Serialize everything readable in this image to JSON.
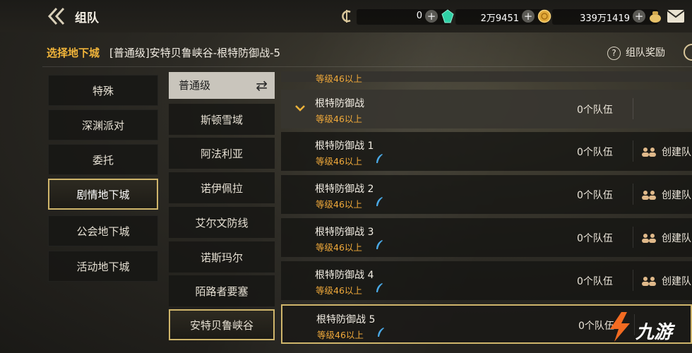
{
  "header": {
    "title": "组队",
    "currencies": [
      {
        "value": "0",
        "icon": "gem-icon",
        "color": "#2fd1a6"
      },
      {
        "value": "2万9451",
        "icon": "gold-coin-icon",
        "color": "#e1a93a"
      },
      {
        "value": "339万1419",
        "icon": "money-bag-icon",
        "color": "#e8c26a"
      }
    ]
  },
  "breadcrumb": {
    "label": "选择地下城",
    "current": "[普通级]安特贝鲁峡谷-根特防御战-5",
    "reward": "组队奖励"
  },
  "categories": [
    {
      "label": "特殊",
      "selected": false
    },
    {
      "label": "深渊派对",
      "selected": false
    },
    {
      "label": "委托",
      "selected": false
    },
    {
      "label": "剧情地下城",
      "selected": true
    },
    {
      "label": "公会地下城",
      "selected": false
    },
    {
      "label": "活动地下城",
      "selected": false
    }
  ],
  "difficulty": {
    "label": "普通级"
  },
  "zones": [
    {
      "label": "斯顿雪域",
      "selected": false
    },
    {
      "label": "阿法利亚",
      "selected": false
    },
    {
      "label": "诺伊佩拉",
      "selected": false
    },
    {
      "label": "艾尔文防线",
      "selected": false
    },
    {
      "label": "诺斯玛尔",
      "selected": false
    },
    {
      "label": "陌路者要塞",
      "selected": false
    },
    {
      "label": "安特贝鲁峡谷",
      "selected": true
    }
  ],
  "dungeons": {
    "partial_level": "等级46以上",
    "group": {
      "name": "根特防御战",
      "level": "等级46以上",
      "count": "0个队伍"
    },
    "rows": [
      {
        "name": "根特防御战 1",
        "level": "等级46以上",
        "count": "0个队伍",
        "create": "创建队",
        "selected": false
      },
      {
        "name": "根特防御战 2",
        "level": "等级46以上",
        "count": "0个队伍",
        "create": "创建队",
        "selected": false
      },
      {
        "name": "根特防御战 3",
        "level": "等级46以上",
        "count": "0个队伍",
        "create": "创建队",
        "selected": false
      },
      {
        "name": "根特防御战 4",
        "level": "等级46以上",
        "count": "0个队伍",
        "create": "创建队",
        "selected": false
      },
      {
        "name": "根特防御战 5",
        "level": "等级46以上",
        "count": "0个队伍",
        "create": "",
        "selected": true
      }
    ]
  },
  "watermark": {
    "text": "九游",
    "color": "#f36b21"
  }
}
